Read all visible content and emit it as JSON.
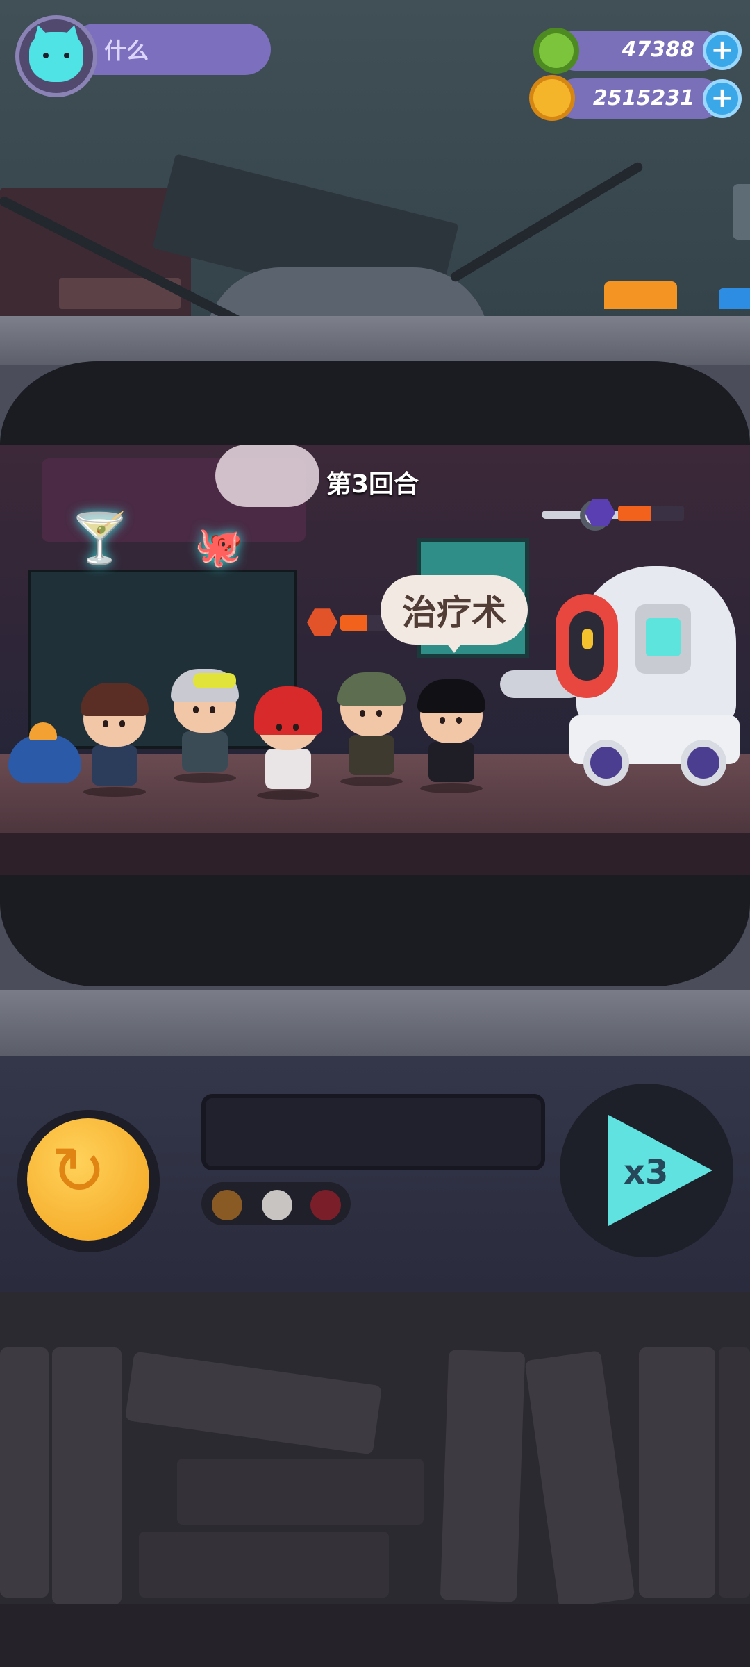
{
  "hud": {
    "player_name": "什么",
    "avatar_icon": "cat-face-icon",
    "currencies": [
      {
        "icon": "donut-gem-icon",
        "value": "47388",
        "color": "#7cc43b"
      },
      {
        "icon": "gold-planet-coin-icon",
        "value": "2515231",
        "color": "#f5b52b"
      }
    ]
  },
  "battle": {
    "round_label": "第3回合",
    "skill_bubble": "治疗术",
    "ally_health_fraction": 0.55,
    "enemy_health_fraction": 0.5,
    "ally_shield_icon": "shield-hex-icon",
    "enemy_moon_icon": "moon-hex-icon"
  },
  "controls": {
    "replay_icon": "replay-icon",
    "speed_label": "x3",
    "indicator_lights": [
      "#8a5a24",
      "#c8c4c2",
      "#7a1f2a"
    ]
  },
  "colors": {
    "accent": "#7b6fbe",
    "speed": "#60e3e0",
    "replay": "#f3a21d"
  }
}
